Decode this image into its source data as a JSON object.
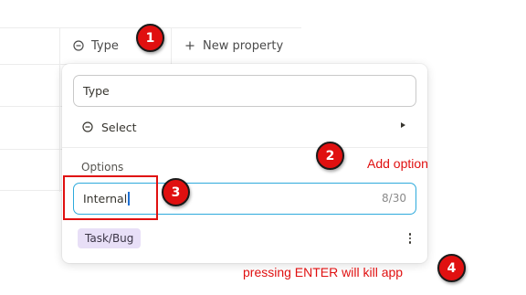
{
  "table_header": {
    "type_label": "Type",
    "new_property_label": "New property"
  },
  "popup": {
    "name_value": "Type",
    "select_label": "Select",
    "options_label": "Options",
    "option_input_value": "Internal",
    "char_count": "8/30",
    "existing_option": "Task/Bug"
  },
  "annotations": {
    "badge_1": "1",
    "badge_2": "2",
    "badge_3": "3",
    "badge_4": "4",
    "add_option": "Add option",
    "enter_warning": "pressing ENTER will kill app"
  },
  "colors": {
    "annotation_red": "#e01010",
    "focus_blue": "#2eaadc",
    "tag_purple": "#e8dff7"
  }
}
